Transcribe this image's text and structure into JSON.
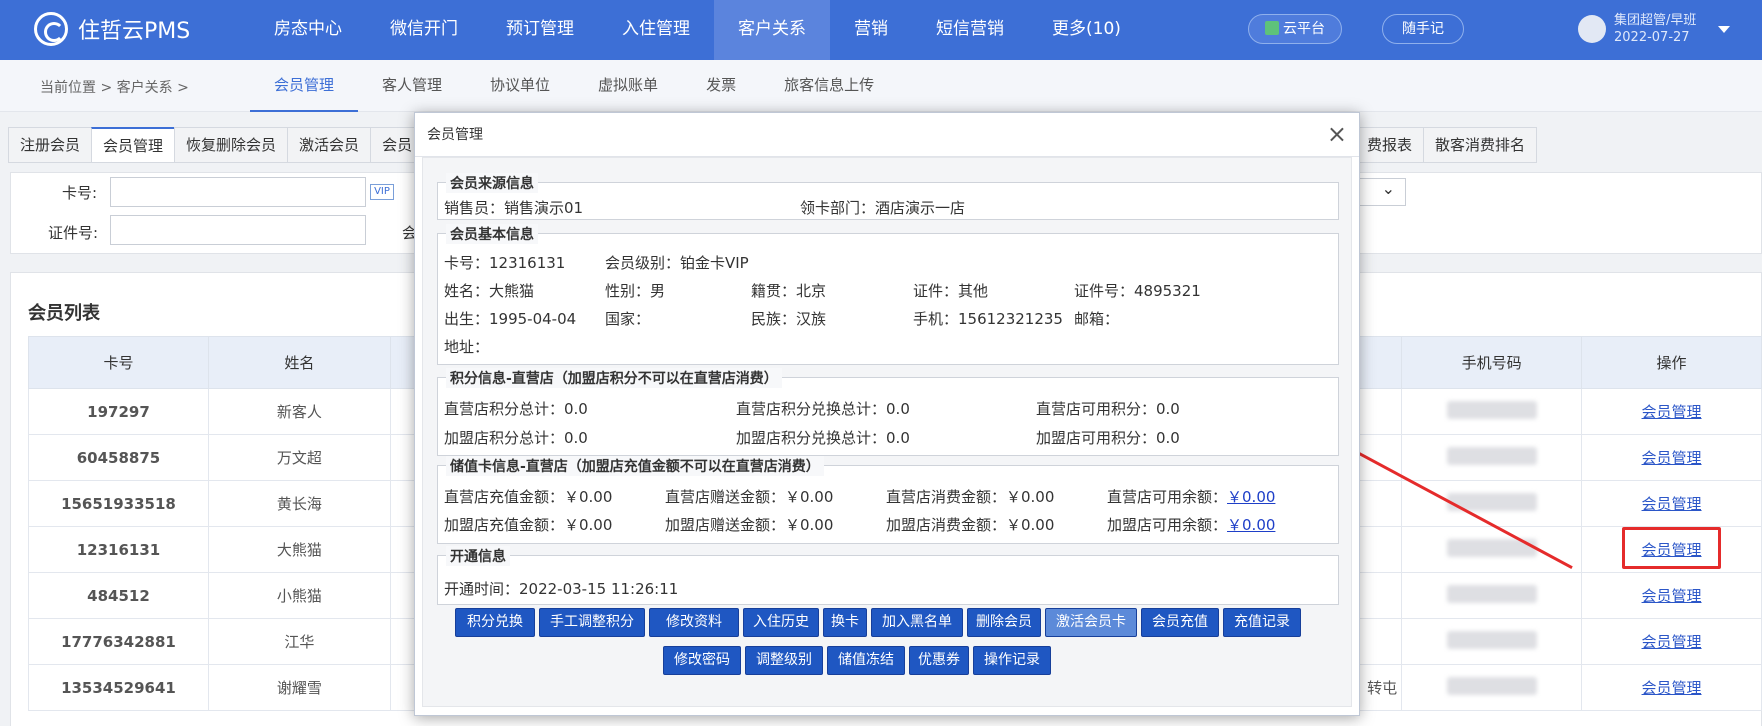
{
  "app": {
    "logo_text": "住哲云PMS"
  },
  "nav": [
    "房态中心",
    "微信开门",
    "预订管理",
    "入住管理",
    "客户关系",
    "营销",
    "短信营销",
    "更多(10)"
  ],
  "nav_active": 4,
  "top": {
    "cloud": "云平台",
    "note": "随手记",
    "user": "集团超管/早班",
    "date": "2022-07-27"
  },
  "crumb": "当前位置 > 客户关系 >",
  "subnav": [
    "会员管理",
    "客人管理",
    "协议单位",
    "虚拟账单",
    "发票",
    "旅客信息上传"
  ],
  "tabs_left": [
    "注册会员",
    "会员管理",
    "恢复删除会员",
    "激活会员",
    "会员"
  ],
  "tabs_right": [
    "费报表",
    "散客消费排名"
  ],
  "filter": {
    "card_label": "卡号:",
    "id_label": "证件号:",
    "vip": "VIP",
    "cut_label": "会"
  },
  "list": {
    "title": "会员列表",
    "headers": {
      "card": "卡号",
      "name": "姓名",
      "phone": "手机号码",
      "op": "操作"
    },
    "rows": [
      {
        "card": "197297",
        "name": "新客人",
        "op": "会员管理"
      },
      {
        "card": "60458875",
        "name": "万文超",
        "op": "会员管理"
      },
      {
        "card": "15651933518",
        "name": "黄长海",
        "op": "会员管理"
      },
      {
        "card": "12316131",
        "name": "大熊猫",
        "op": "会员管理"
      },
      {
        "card": "484512",
        "name": "小熊猫",
        "op": "会员管理"
      },
      {
        "card": "17776342881",
        "name": "江华",
        "op": "会员管理"
      },
      {
        "card": "13534529641",
        "name": "谢耀雪",
        "op": "会员管理"
      }
    ],
    "stray": "转屯"
  },
  "modal": {
    "title": "会员管理",
    "close": "×",
    "source": {
      "legend": "会员来源信息",
      "seller": "销售员：销售演示01",
      "dept": "领卡部门：酒店演示一店"
    },
    "basic": {
      "legend": "会员基本信息",
      "card": "卡号：12316131",
      "level": "会员级别：铂金卡VIP",
      "name": "姓名：大熊猫",
      "sex": "性别：男",
      "native": "籍贯：北京",
      "idtype": "证件：其他",
      "idno": "证件号：4895321",
      "birth": "出生：1995-04-04",
      "country": "国家：",
      "nation": "民族：汉族",
      "mobile": "手机：15612321235",
      "email": "邮箱：",
      "address": "地址："
    },
    "points": {
      "legend": "积分信息-直营店（加盟店积分不可以在直营店消费）",
      "d_total": "直营店积分总计：0.0",
      "d_exch": "直营店积分兑换总计：0.0",
      "d_avail": "直营店可用积分：0.0",
      "f_total": "加盟店积分总计：0.0",
      "f_exch": "加盟店积分兑换总计：0.0",
      "f_avail": "加盟店可用积分：0.0"
    },
    "stored": {
      "legend": "储值卡信息-直营店（加盟店充值金额不可以在直营店消费）",
      "d_recharge": "直营店充值金额：￥0.00",
      "d_gift": "直营店赠送金额：￥0.00",
      "d_consume": "直营店消费金额：￥0.00",
      "d_avail_label": "直营店可用余额：",
      "d_avail_value": "￥0.00",
      "f_recharge": "加盟店充值金额：￥0.00",
      "f_gift": "加盟店赠送金额：￥0.00",
      "f_consume": "加盟店消费金额：￥0.00",
      "f_avail_label": "加盟店可用余额：",
      "f_avail_value": "￥0.00"
    },
    "open": {
      "legend": "开通信息",
      "time": "开通时间：2022-03-15 11:26:11"
    },
    "buttons_row1": [
      "积分兑换",
      "手工调整积分",
      "修改资料",
      "入住历史",
      "换卡",
      "加入黑名单",
      "删除会员",
      "激活会员卡",
      "会员充值",
      "充值记录"
    ],
    "buttons_row2": [
      "修改密码",
      "调整级别",
      "储值冻结",
      "优惠券",
      "操作记录"
    ]
  },
  "colors": {
    "brand": "#3d6fd6",
    "button": "#1f57c2",
    "annotation": "#e52b2b"
  }
}
